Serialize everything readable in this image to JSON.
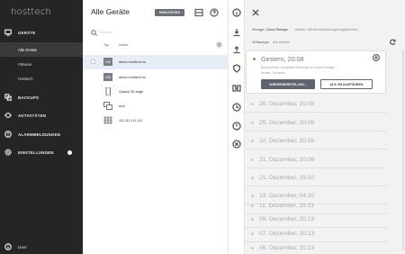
{
  "sidebar": {
    "logo": "hosttech",
    "items": [
      {
        "label": "GERÄTE",
        "icon": "monitor-icon"
      },
      {
        "label": "BACKUPS",
        "icon": "backups-icon"
      },
      {
        "label": "AKTIVITÄTEN",
        "icon": "activity-icon"
      },
      {
        "label": "ALARMMELDUNGEN",
        "icon": "alert-icon"
      },
      {
        "label": "EINSTELLUNGEN",
        "icon": "settings-icon"
      }
    ],
    "sub_items": [
      "Alle Geräte",
      "VMware",
      "Hosttech"
    ],
    "user": "User"
  },
  "list": {
    "title": "Alle Geräte",
    "add_label": "HINZUFÜGEN",
    "search_placeholder": "Suchen",
    "col_type": "Typ",
    "col_name": "Name",
    "rows": [
      {
        "name": "demo.hosttech.eu",
        "type": "vm",
        "selected": true
      },
      {
        "name": "demo.hosttech.eu",
        "type": "vm",
        "selected": false
      },
      {
        "name": "Galaxy S6 edge",
        "type": "phone",
        "selected": false
      },
      {
        "name": "esxi",
        "type": "server",
        "selected": false
      },
      {
        "name": "111.111.111.111",
        "type": "grid",
        "selected": false
      }
    ]
  },
  "detail": {
    "storage_label": "Storage:",
    "storage_value": "Cloud Storage",
    "storage_link": "Weitere Wiederherstellungsmöglichkeiten...",
    "backups_count": "18 Backups",
    "backups_link": "Alle löschen",
    "current": {
      "date": "Gestern, 20:08",
      "plan": "Backup-Plan: Komplette Maschine zu Cloud Storage",
      "status": "Inhalte: Laufwerk",
      "restore_label": "WIEDERHERSTELLEN...",
      "run_vm_label": "ALS VM AUSFÜHREN"
    },
    "backups": [
      "26. Dezember, 20:08",
      "25. Dezember, 20:08",
      "22. Dezember, 20:08",
      "21. Dezember, 20:08",
      "21. Dezember, 15:10",
      "13. Dezember, 04:20",
      "11. Dezember, 20:13",
      "08. Dezember, 20:13",
      "07. Dezember, 20:13",
      "06. Dezember, 20:13"
    ]
  },
  "colors": {
    "sidebar_bg": "#252525",
    "selected_row": "#e6edf5",
    "accent_green": "#6aa84f",
    "detail_bg": "#f2f2f2"
  }
}
